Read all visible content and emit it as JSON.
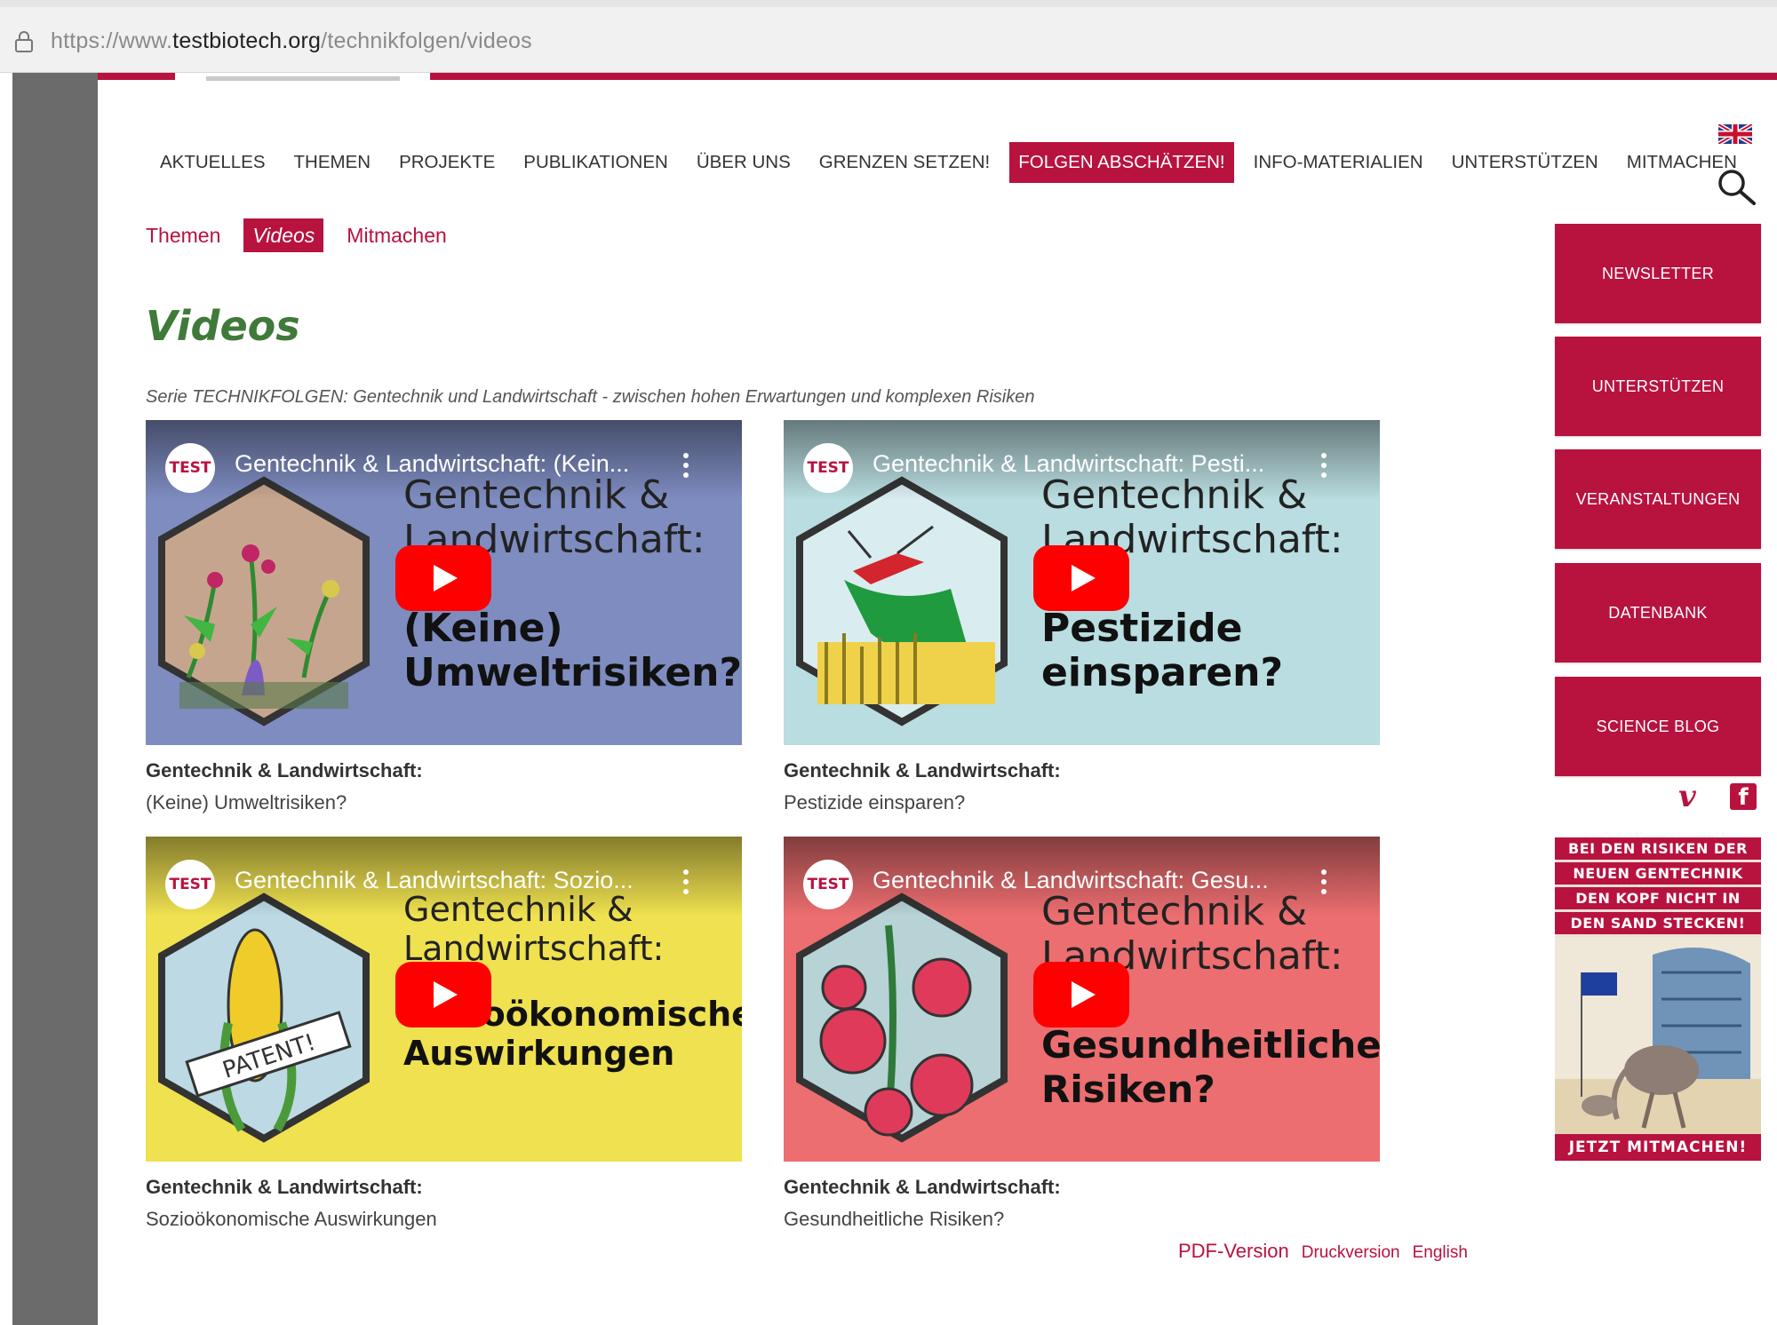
{
  "browser": {
    "url_prefix": "https://www.",
    "url_domain": "testbiotech.org",
    "url_path": "/technikfolgen/videos"
  },
  "nav": {
    "items": [
      "AKTUELLES",
      "THEMEN",
      "PROJEKTE",
      "PUBLIKATIONEN",
      "ÜBER UNS",
      "GRENZEN SETZEN!",
      "FOLGEN ABSCHÄTZEN!",
      "INFO-MATERIALIEN",
      "UNTERSTÜTZEN",
      "MITMACHEN"
    ],
    "active": "FOLGEN ABSCHÄTZEN!"
  },
  "subnav": {
    "items": [
      "Themen",
      "Videos",
      "Mitmachen"
    ],
    "active": "Videos"
  },
  "page": {
    "title": "Videos",
    "series": "Serie TECHNIKFOLGEN: Gentechnik und Landwirtschaft - zwischen hohen Erwartungen und komplexen Risiken"
  },
  "videos": [
    {
      "player_title": "Gentechnik & Landwirtschaft: (Kein...",
      "logo": "TEST",
      "headline1": "Gentechnik &",
      "headline2": "Landwirtschaft:",
      "sub1": "(Keine)",
      "sub2": "Umweltrisiken?",
      "caption_title": "Gentechnik & Landwirtschaft:",
      "caption_sub": "(Keine) Umweltrisiken?",
      "bg": "#7e8cc0"
    },
    {
      "player_title": "Gentechnik & Landwirtschaft: Pesti...",
      "logo": "TEST",
      "headline1": "Gentechnik &",
      "headline2": "Landwirtschaft:",
      "sub1": "Pestizide",
      "sub2": "einsparen?",
      "caption_title": "Gentechnik & Landwirtschaft:",
      "caption_sub": "Pestizide einsparen?",
      "bg": "#b9dde0"
    },
    {
      "player_title": "Gentechnik & Landwirtschaft: Sozio...",
      "logo": "TEST",
      "headline1": "Gentechnik &",
      "headline2": "Landwirtschaft:",
      "sub1": "Sozioökonomische",
      "sub2": "Auswirkungen",
      "caption_title": "Gentechnik & Landwirtschaft:",
      "caption_sub": "Sozioökonomische Auswirkungen",
      "bg": "#efe150",
      "hex_label": "PATENT!"
    },
    {
      "player_title": "Gentechnik & Landwirtschaft: Gesu...",
      "logo": "TEST",
      "headline1": "Gentechnik &",
      "headline2": "Landwirtschaft:",
      "sub1": "Gesundheitliche",
      "sub2": "Risiken?",
      "caption_title": "Gentechnik & Landwirtschaft:",
      "caption_sub": "Gesundheitliche Risiken?",
      "bg": "#ec6e70"
    }
  ],
  "footer_links": {
    "pdf": "PDF-Version",
    "print": "Druckversion",
    "english": "English"
  },
  "sidebar": {
    "buttons": [
      "NEWSLETTER",
      "UNTERSTÜTZEN",
      "VERANSTALTUNGEN",
      "DATENBANK",
      "SCIENCE BLOG"
    ],
    "social_vimeo": "v",
    "social_facebook": "f",
    "banner_lines": [
      "BEI DEN RISIKEN DER",
      "NEUEN GENTECHNIK",
      "DEN KOPF NICHT IN",
      "DEN SAND STECKEN!"
    ],
    "banner_cta": "JETZT MITMACHEN!"
  },
  "colors": {
    "brand": "#b8123f",
    "title_green": "#3f7a3a"
  }
}
